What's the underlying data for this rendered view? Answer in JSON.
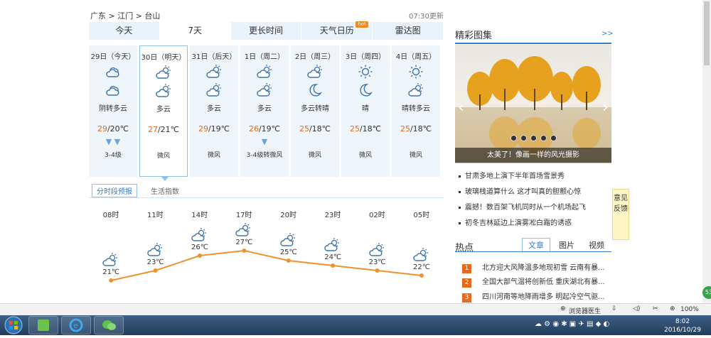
{
  "breadcrumb": {
    "text": "广东 > 江门 > 台山"
  },
  "updated": "07:30更新",
  "tabs": [
    {
      "label": "今天"
    },
    {
      "label": "7天"
    },
    {
      "label": "更长时间"
    },
    {
      "label": "天气日历"
    },
    {
      "label": "雷达图"
    }
  ],
  "hot_badge": "hot",
  "days": [
    {
      "date": "29日（今天）",
      "icon1": "partly-cloudy-icon",
      "icon2": "partly-cloudy-icon",
      "desc": "阴转多云",
      "hi": "29",
      "lo": "/20℃",
      "arrows": "▼ ▼",
      "wind": "3-4级"
    },
    {
      "date": "30日（明天）",
      "icon1": "sun-cloud-icon",
      "icon2": "sun-cloud-icon",
      "desc": "多云",
      "hi": "27",
      "lo": "/21℃",
      "arrows": "",
      "wind": "微风"
    },
    {
      "date": "31日（后天）",
      "icon1": "sun-cloud-icon",
      "icon2": "sun-cloud-icon",
      "desc": "多云",
      "hi": "29",
      "lo": "/19℃",
      "arrows": "",
      "wind": "微风"
    },
    {
      "date": "1日（周二）",
      "icon1": "sun-cloud-icon",
      "icon2": "sun-cloud-icon",
      "desc": "多云",
      "hi": "26",
      "lo": "/19℃",
      "arrows": "▼",
      "wind": "3-4级转微风"
    },
    {
      "date": "2日（周三）",
      "icon1": "sun-cloud-icon",
      "icon2": "moon-icon",
      "desc": "多云转晴",
      "hi": "25",
      "lo": "/18℃",
      "arrows": "",
      "wind": "微风"
    },
    {
      "date": "3日（周四）",
      "icon1": "sun-icon",
      "icon2": "moon-icon",
      "desc": "晴",
      "hi": "25",
      "lo": "/18℃",
      "arrows": "",
      "wind": "微风"
    },
    {
      "date": "4日（周五）",
      "icon1": "sun-icon",
      "icon2": "sun-cloud-icon",
      "desc": "晴转多云",
      "hi": "25",
      "lo": "/18℃",
      "arrows": "",
      "wind": "微风"
    }
  ],
  "subtabs": {
    "forecast": "分时段预报",
    "index": "生活指数"
  },
  "hourly": [
    {
      "time": "08时",
      "temp": "21℃",
      "value": 21
    },
    {
      "time": "11时",
      "temp": "23℃",
      "value": 23
    },
    {
      "time": "14时",
      "temp": "26℃",
      "value": 26
    },
    {
      "time": "17时",
      "temp": "27℃",
      "value": 27
    },
    {
      "time": "20时",
      "temp": "25℃",
      "value": 25
    },
    {
      "time": "23时",
      "temp": "24℃",
      "value": 24
    },
    {
      "time": "02时",
      "temp": "23℃",
      "value": 23
    },
    {
      "time": "05时",
      "temp": "22℃",
      "value": 22
    }
  ],
  "gallery": {
    "title": "精彩图集",
    "more": ">>",
    "caption": "太美了！像画一样的风光摄影"
  },
  "news": [
    "甘肃多地上演下半年首场雪景秀",
    "玻璃栈道算什么 这才叫真的胆颤心惊",
    "震撼！数百架飞机同时从一个机场起飞",
    "初冬吉林延边上演雾凇白霜的诱惑"
  ],
  "feedback": "意见反馈",
  "hot": {
    "title": "热点",
    "tabs": [
      "文章",
      "图片",
      "视频"
    ],
    "items": [
      {
        "num": "1",
        "text": "北方迎大风降温多地现初雪 云南有暴..."
      },
      {
        "num": "2",
        "text": "全国大部气温将创新低 重庆湖北有暴..."
      },
      {
        "num": "3",
        "text": "四川河南等地降雨增多 明起冷空气驱..."
      }
    ]
  },
  "side_badge": "53",
  "statusbar": {
    "doctor": "浏览器医生",
    "zoom": "100%"
  },
  "clock": {
    "time": "8:02",
    "date": "2016/10/29"
  }
}
